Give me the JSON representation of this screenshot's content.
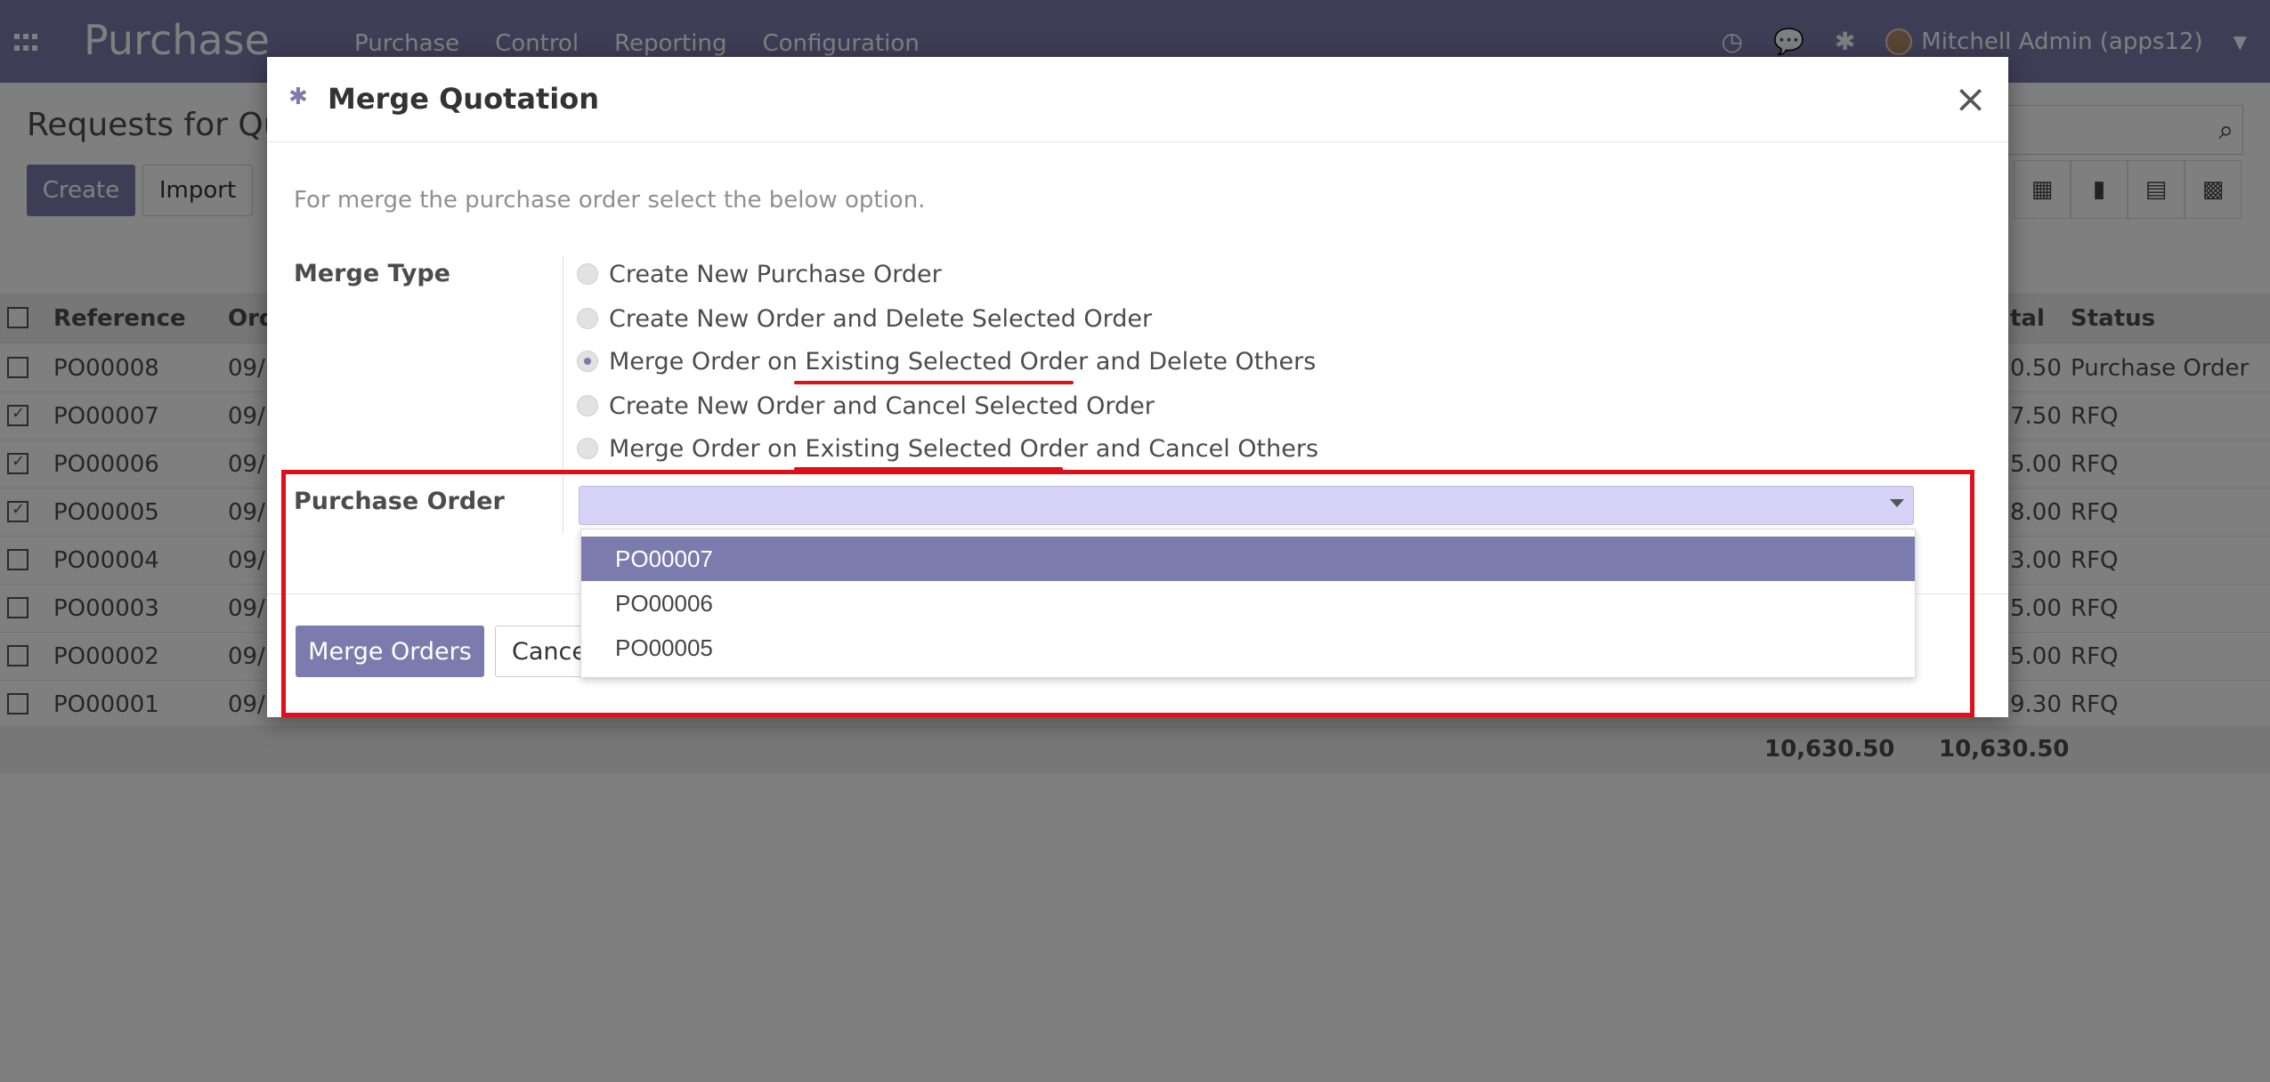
{
  "navbar": {
    "app_name": "Purchase",
    "menu": [
      "Purchase",
      "Control",
      "Reporting",
      "Configuration"
    ],
    "user": "Mitchell Admin (apps12)",
    "icons": [
      "apps-icon",
      "clock-icon",
      "chat-icon",
      "bug-icon",
      "avatar",
      "caret-down-icon"
    ]
  },
  "control_panel": {
    "title": "Requests for Qu",
    "create_label": "Create",
    "import_label": "Import",
    "views": [
      "list-view-icon",
      "graph-view-icon",
      "calendar-view-icon",
      "kanban-view-icon"
    ]
  },
  "list": {
    "headers": {
      "reference": "Reference",
      "order": "Ord",
      "total": "tal",
      "status": "Status"
    },
    "rows": [
      {
        "ref": "PO00008",
        "date": "09/",
        "total": "0.50",
        "status": "Purchase Order",
        "checked": false
      },
      {
        "ref": "PO00007",
        "date": "09/",
        "total": "7.50",
        "status": "RFQ",
        "checked": true
      },
      {
        "ref": "PO00006",
        "date": "09/",
        "total": "5.00",
        "status": "RFQ",
        "checked": true
      },
      {
        "ref": "PO00005",
        "date": "09/",
        "total": "8.00",
        "status": "RFQ",
        "checked": true
      },
      {
        "ref": "PO00004",
        "date": "09/",
        "total": "3.00",
        "status": "RFQ",
        "checked": false
      },
      {
        "ref": "PO00003",
        "date": "09/",
        "total": "5.00",
        "status": "RFQ",
        "checked": false
      },
      {
        "ref": "PO00002",
        "date": "09/",
        "total": "5.00",
        "status": "RFQ",
        "checked": false
      },
      {
        "ref": "PO00001",
        "date": "09/",
        "total": "9.30",
        "status": "RFQ",
        "checked": false
      }
    ],
    "footer_totals": [
      "10,630.50",
      "10,630.50"
    ]
  },
  "modal": {
    "title": "Merge Quotation",
    "close_symbol": "×",
    "intro": "For merge the purchase order select the below option.",
    "merge_type_label": "Merge Type",
    "options": [
      "Create New Purchase Order",
      "Create New Order and Delete Selected Order",
      "Merge Order on Existing Selected Order and Delete Others",
      "Create New Order and Cancel Selected Order",
      "Merge Order on Existing Selected Order and Cancel Others"
    ],
    "selected_option": "Merge Order on Existing Selected Order and Delete Others",
    "purchase_order_label": "Purchase Order",
    "purchase_order_value": "",
    "dropdown_options": [
      "PO00007",
      "PO00006",
      "PO00005"
    ],
    "highlighted_option": "PO00007",
    "merge_button": "Merge Orders",
    "cancel_button": "Cancel"
  },
  "colors": {
    "primary": "#7c7bad",
    "highlight": "#e0101a",
    "select_bg": "#d6d2f5"
  }
}
